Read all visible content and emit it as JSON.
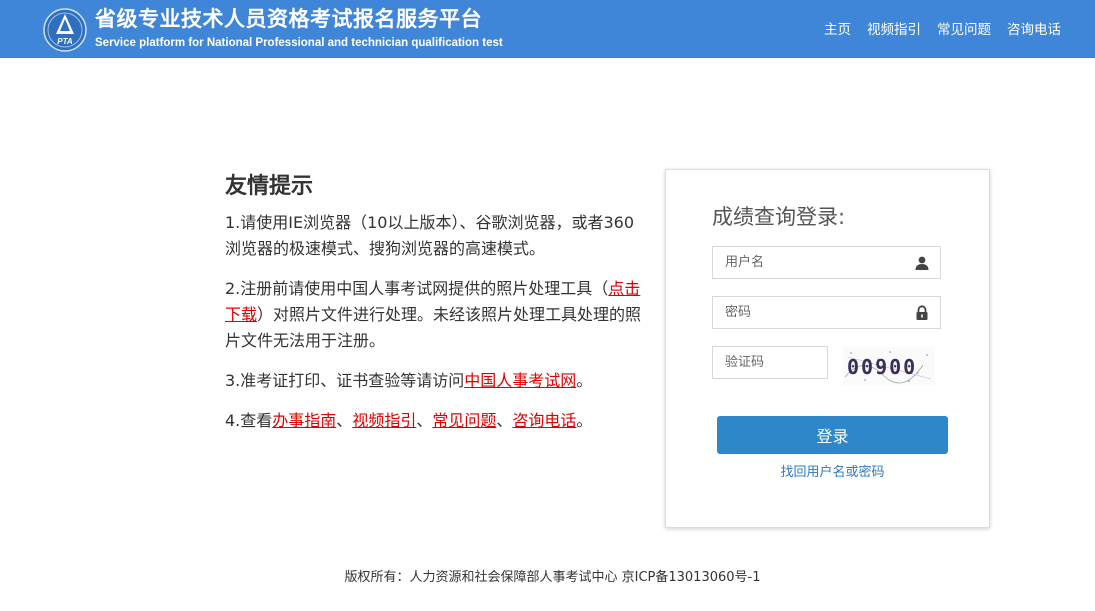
{
  "header": {
    "title_cn": "省级专业技术人员资格考试报名服务平台",
    "title_en": "Service platform for National Professional and technician qualification test",
    "logo_text": "PTA",
    "nav": [
      "主页",
      "视频指引",
      "常见问题",
      "咨询电话"
    ]
  },
  "tips": {
    "heading": "友情提示",
    "item1": "1.请使用IE浏览器（10以上版本）、谷歌浏览器，或者360浏览器的极速模式、搜狗浏览器的高速模式。",
    "item2_a": "2.注册前请使用中国人事考试网提供的照片处理工具（",
    "item2_link": "点击下载",
    "item2_b": "）对照片文件进行处理。未经该照片处理工具处理的照片文件无法用于注册。",
    "item3_a": "3.准考证打印、证书查验等请访问",
    "item3_link": "中国人事考试网",
    "item3_b": "。",
    "item4_a": "4.查看",
    "item4_links": [
      "办事指南",
      "视频指引",
      "常见问题",
      "咨询电话"
    ],
    "item4_sep": "、",
    "item4_end": "。"
  },
  "login": {
    "title": "成绩查询登录:",
    "username_placeholder": "用户名",
    "password_placeholder": "密码",
    "captcha_placeholder": "验证码",
    "captcha_text": "00900",
    "submit_label": "登录",
    "forgot_label": "找回用户名或密码"
  },
  "footer": {
    "text": "版权所有：人力资源和社会保障部人事考试中心 京ICP备13013060号-1"
  },
  "colors": {
    "header_bg": "#3f86d8",
    "button_bg": "#2d87c9",
    "link_red": "#e00000",
    "link_blue": "#2d78c4"
  }
}
